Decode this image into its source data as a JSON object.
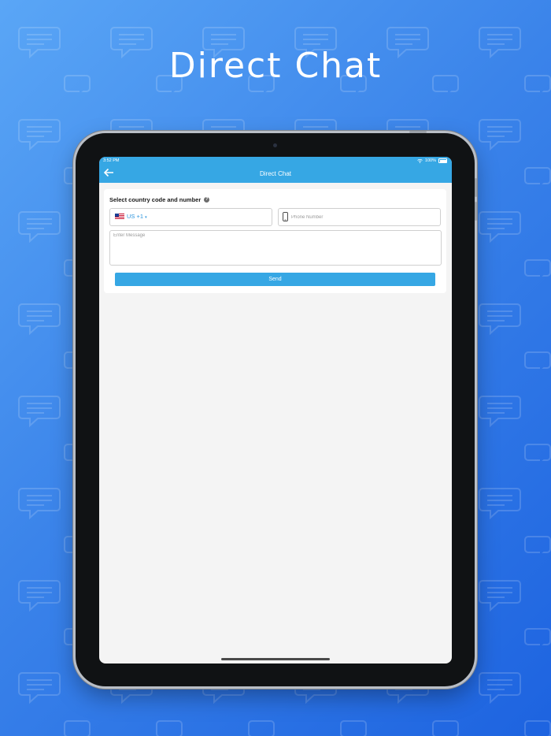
{
  "page": {
    "headline": "Direct Chat"
  },
  "status_bar": {
    "time": "3:52 PM",
    "battery_percent": "100%",
    "icons": [
      "wifi-icon",
      "battery-icon"
    ]
  },
  "nav": {
    "title": "Direct Chat",
    "back_icon": "arrow-left-icon"
  },
  "form": {
    "label": "Select country code and number",
    "help_icon": "question-icon",
    "country": {
      "flag_icon": "us-flag-icon",
      "code_label": "US +1",
      "dropdown_icon": "caret-down-icon"
    },
    "phone": {
      "icon": "mobile-phone-icon",
      "placeholder": "Phone Number",
      "value": ""
    },
    "message": {
      "placeholder": "Enter Message",
      "value": ""
    },
    "send_label": "Send"
  },
  "colors": {
    "background_start": "#5aa6f6",
    "background_end": "#1d63e0",
    "app_bar": "#36a7e4",
    "send_button": "#36a7e4",
    "country_code_text": "#2d95dd",
    "screen_bg": "#f4f4f4"
  }
}
